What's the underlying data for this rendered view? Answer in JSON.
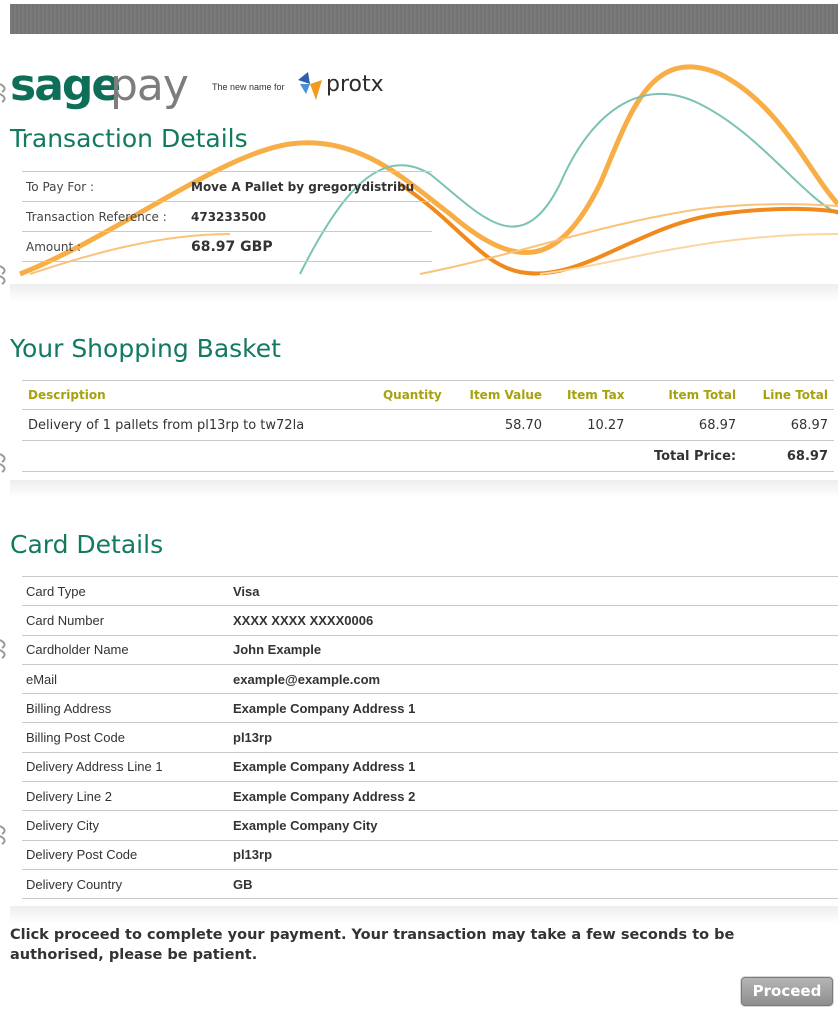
{
  "brand": {
    "sage": "sage",
    "pay": "pay",
    "tagline": "The new name for",
    "partner": "protx",
    "primary_color": "#127a60",
    "accent_color": "#f39a1e"
  },
  "transaction": {
    "title": "Transaction Details",
    "rows": [
      {
        "label": "To Pay For :",
        "value": "Move A Pallet by gregorydistribu"
      },
      {
        "label": "Transaction Reference :",
        "value": "473233500"
      },
      {
        "label": "Amount :",
        "value": "68.97 GBP"
      }
    ]
  },
  "basket": {
    "title": "Your Shopping Basket",
    "headers": [
      "Description",
      "Quantity",
      "Item Value",
      "Item Tax",
      "Item Total",
      "Line Total"
    ],
    "header_color": "#a6a20f",
    "items": [
      {
        "description": "Delivery of 1 pallets from pl13rp to tw72la",
        "quantity": "",
        "item_value": "58.70",
        "item_tax": "10.27",
        "item_total": "68.97",
        "line_total": "68.97"
      }
    ],
    "total_label": "Total Price:",
    "total_value": "68.97"
  },
  "card": {
    "title": "Card Details",
    "rows": [
      {
        "label": "Card Type",
        "value": "Visa"
      },
      {
        "label": "Card Number",
        "value": "XXXX XXXX XXXX0006"
      },
      {
        "label": "Cardholder Name",
        "value": "John Example"
      },
      {
        "label": "eMail",
        "value": "example@example.com"
      },
      {
        "label": "Billing Address",
        "value": "Example Company Address 1"
      },
      {
        "label": "Billing Post Code",
        "value": "pl13rp"
      },
      {
        "label": "Delivery Address Line 1",
        "value": "Example Company Address 1"
      },
      {
        "label": "Delivery Line 2",
        "value": "Example Company Address 2"
      },
      {
        "label": "Delivery City",
        "value": "Example Company City"
      },
      {
        "label": "Delivery Post Code",
        "value": "pl13rp"
      },
      {
        "label": "Delivery Country",
        "value": "GB"
      }
    ]
  },
  "footer": {
    "notice": "Click proceed to complete your payment. Your transaction may take a few seconds to be authorised, please be patient.",
    "proceed_label": "Proceed"
  }
}
